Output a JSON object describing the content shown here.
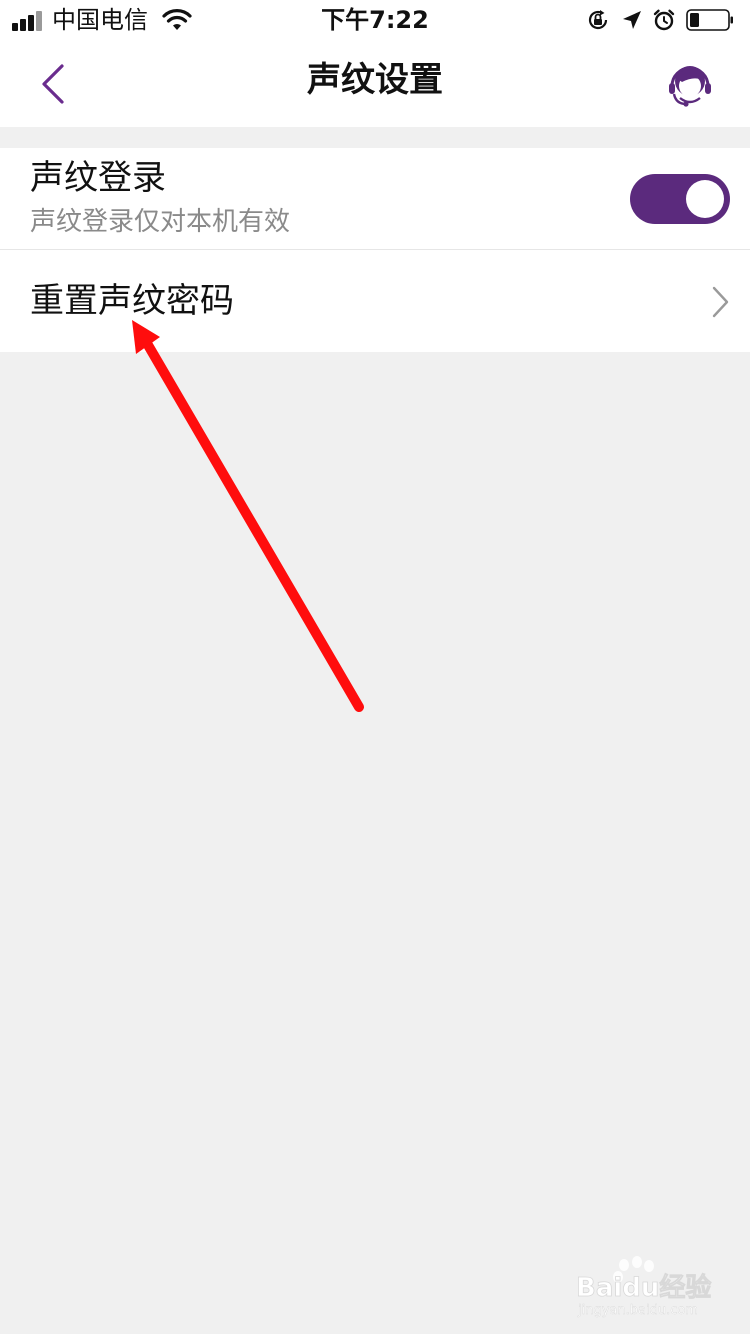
{
  "status_bar": {
    "carrier": "中国电信",
    "time": "下午7:22",
    "icons": [
      "signal-icon",
      "wifi-icon",
      "orientation-lock-icon",
      "location-arrow-icon",
      "alarm-icon",
      "battery-icon"
    ],
    "battery_level": 0.25
  },
  "nav": {
    "title": "声纹设置",
    "back_icon": "chevron-left-icon",
    "service_icon": "customer-service-icon"
  },
  "settings": {
    "voice_login": {
      "title": "声纹登录",
      "subtitle": "声纹登录仅对本机有效",
      "enabled": true
    },
    "reset_password": {
      "title": "重置声纹密码",
      "icon": "chevron-right-icon"
    }
  },
  "annotation": {
    "type": "arrow",
    "color": "#ff0d0d"
  },
  "watermark": {
    "text": "Baidu经验",
    "url_text": "jingyan.baidu.com"
  },
  "colors": {
    "accent": "#5b2a7d",
    "background": "#f0f0f0"
  }
}
